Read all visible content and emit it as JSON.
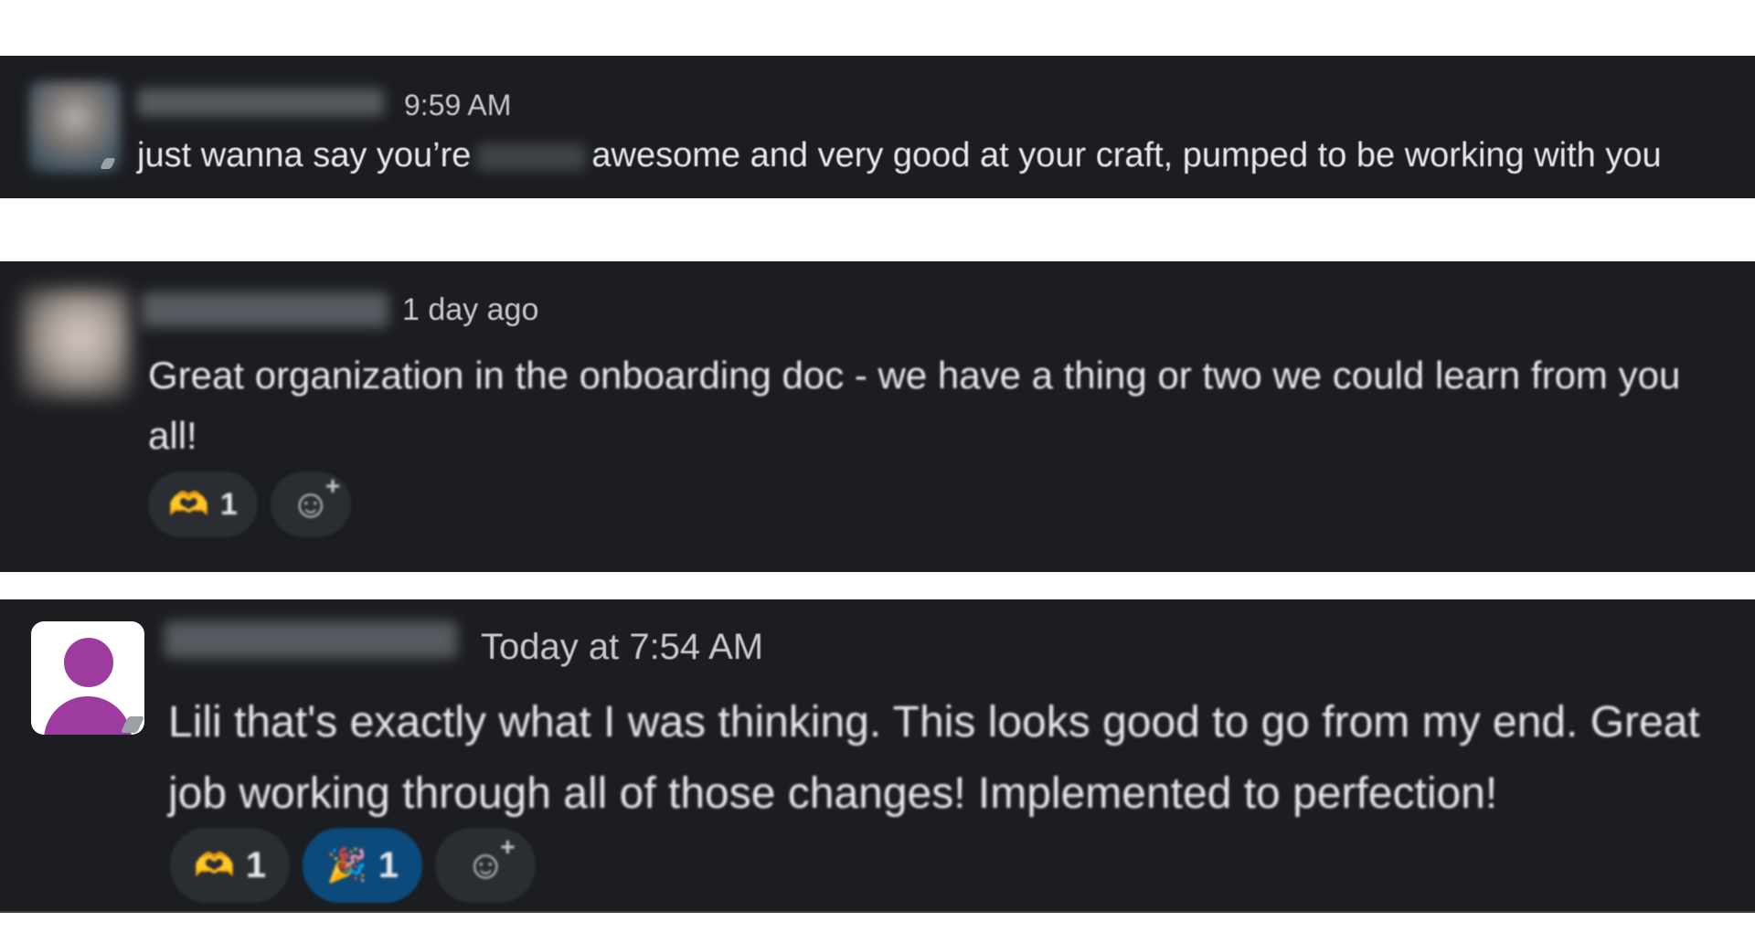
{
  "messages": [
    {
      "time": "9:59 AM",
      "text_before": "just wanna say you’re",
      "text_after": "awesome and very good at your craft, pumped to be working with you"
    },
    {
      "time": "1 day ago",
      "text": "Great organization in the onboarding doc - we have a thing or two we could learn from you all!",
      "reactions": [
        {
          "icon": "heart-hands-icon",
          "glyph": "🫶",
          "count": "1"
        }
      ]
    },
    {
      "time": "Today at 7:54 AM",
      "text": "Lili that's exactly what I was thinking. This looks good to go from my end. Great job working through all of those changes! Implemented to perfection!",
      "reactions": [
        {
          "icon": "heart-hands-icon",
          "glyph": "🫶",
          "count": "1"
        },
        {
          "icon": "party-popper-icon",
          "glyph": "🎉",
          "count": "1"
        }
      ]
    }
  ],
  "colors": {
    "message_bg": "#1b1d21",
    "reaction_bg": "#2a2d31",
    "reaction_active_bg": "#0b4a7a",
    "default_avatar": "#9e3b9f"
  }
}
